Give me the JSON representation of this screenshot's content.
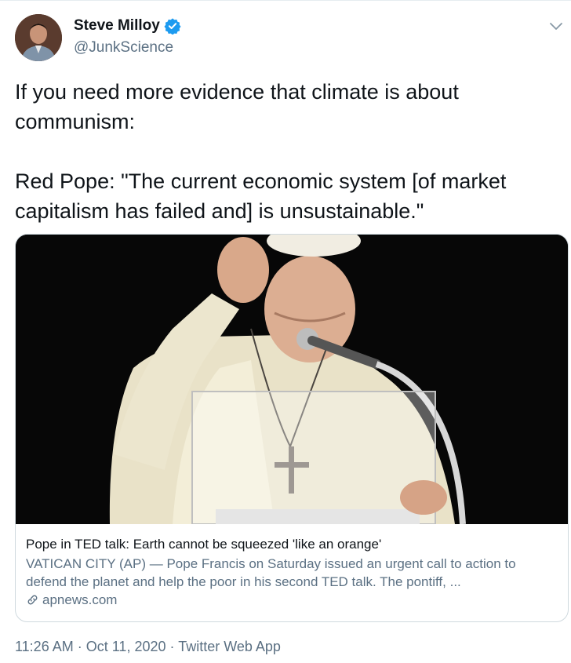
{
  "author": {
    "display_name": "Steve Milloy",
    "handle": "@JunkScience",
    "verified": true
  },
  "tweet": {
    "text": "If you need more evidence  that climate is about\ncommunism:\n\nRed Pope: \"The current economic system [of market\ncapitalism has failed and] is unsustainable.\""
  },
  "card": {
    "title": "Pope in TED talk: Earth cannot be squeezed 'like an orange'",
    "description": "VATICAN CITY (AP) — Pope Francis on Saturday issued an urgent call to action to defend the planet and help the poor in his second TED talk. The pontiff, ...",
    "domain": "apnews.com"
  },
  "meta": {
    "time": "11:26 AM",
    "date": "Oct 11, 2020",
    "source": "Twitter Web App",
    "separator": "·"
  },
  "colors": {
    "text": "#0f1419",
    "secondary": "#5b7083",
    "verified": "#1d9bf0",
    "border": "#cfd9de"
  },
  "icons": [
    "verified-badge-icon",
    "chevron-down-icon",
    "link-icon"
  ]
}
